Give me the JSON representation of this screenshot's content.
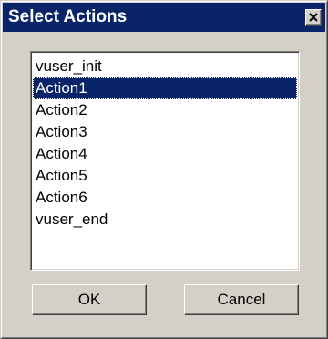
{
  "window": {
    "title": "Select Actions",
    "close_icon": "close-x"
  },
  "actions": {
    "items": [
      "vuser_init",
      "Action1",
      "Action2",
      "Action3",
      "Action4",
      "Action5",
      "Action6",
      "vuser_end"
    ],
    "selected": "Action1"
  },
  "buttons": {
    "ok_label": "OK",
    "cancel_label": "Cancel"
  },
  "colors": {
    "titlebar": "#0a246a",
    "face": "#d4d0c8",
    "selection": "#0a246a"
  }
}
